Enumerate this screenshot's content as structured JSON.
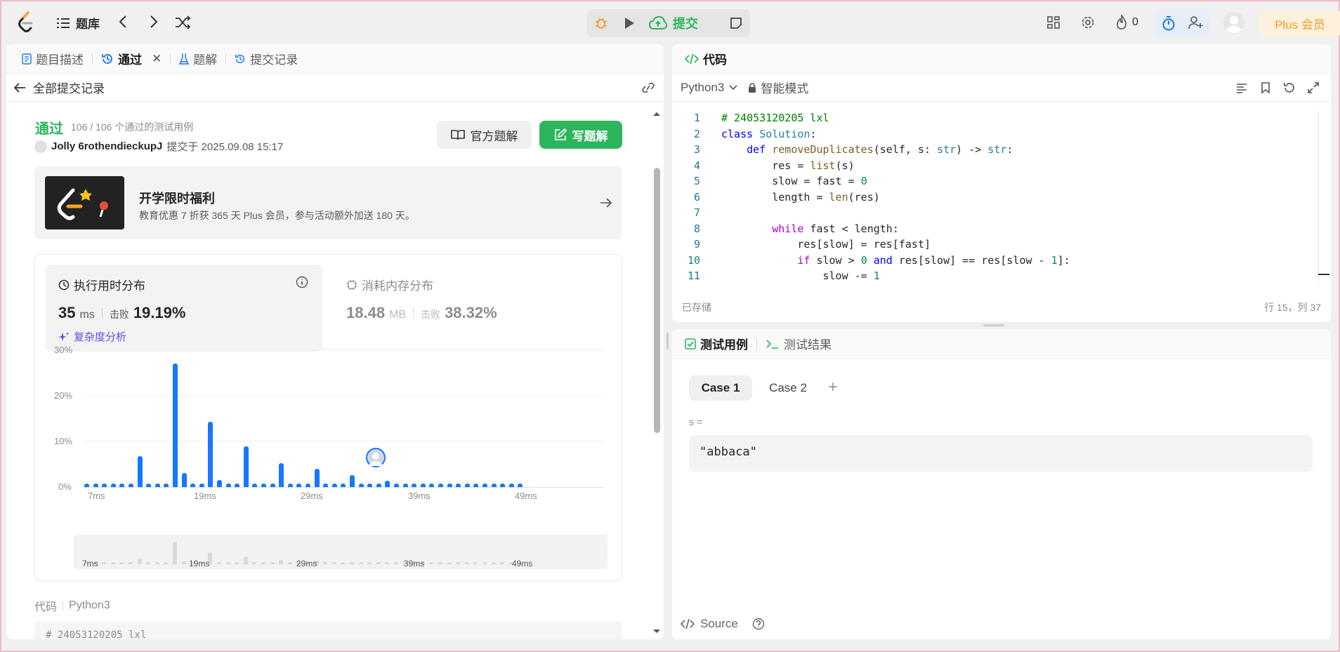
{
  "topbar": {
    "problem_bank": "题库",
    "submit": "提交",
    "streak": "0",
    "plus": "Plus 会员"
  },
  "left": {
    "tabs": [
      {
        "label": "题目描述"
      },
      {
        "label": "通过"
      },
      {
        "label": "题解"
      },
      {
        "label": "提交记录"
      }
    ],
    "back_label": "全部提交记录",
    "status": "通过",
    "cases": "106 / 106 个通过的测试用例",
    "user": "Jolly 6rothendieckupJ",
    "submitted_at": "提交于 2025.09.08 15:17",
    "official_btn": "官方题解",
    "write_btn": "写题解",
    "promo_title": "开学限时福利",
    "promo_desc": "教育优惠 7 折获 365 天 Plus 会员，参与活动额外加送 180 天。",
    "runtime_title": "执行用时分布",
    "runtime_val": "35",
    "runtime_unit": "ms",
    "beat_label": "击败",
    "runtime_beat": "19.19%",
    "complexity": "复杂度分析",
    "mem_title": "消耗内存分布",
    "mem_val": "18.48",
    "mem_unit": "MB",
    "mem_beat_label": "击败",
    "mem_beat": "38.32%",
    "code_label": "代码",
    "code_lang": "Python3",
    "code_preview": "# 24053120205 lxl"
  },
  "chart_data": {
    "type": "bar",
    "ylabel_ticks": [
      "30%",
      "20%",
      "10%",
      "0%"
    ],
    "xtick_labels": [
      "7ms",
      "19ms",
      "29ms",
      "39ms",
      "49ms"
    ],
    "ylim": [
      0,
      30
    ],
    "values": [
      0.8,
      0.8,
      0.8,
      0.8,
      0.8,
      0.8,
      6.8,
      0.8,
      0.8,
      0.8,
      27,
      3,
      0.8,
      0.8,
      14.2,
      1.5,
      0.8,
      0.8,
      8.9,
      0.8,
      0.8,
      0.8,
      5.2,
      0.8,
      0.8,
      0.8,
      4,
      0.8,
      0.8,
      0.8,
      2.6,
      0.8,
      0.8,
      0.8,
      1.4,
      0.8,
      0.8,
      0.8,
      0.8,
      0.8,
      0.8,
      0.8,
      0.8,
      0.8,
      0.8,
      0.8,
      0.8,
      0.8,
      0.8,
      0.8
    ]
  },
  "right": {
    "code_tab": "代码",
    "lang": "Python3",
    "smart": "智能模式",
    "code": [
      "# 24053120205 lxl",
      "class Solution:",
      "    def removeDuplicates(self, s: str) -> str:",
      "        res = list(s)",
      "        slow = fast = 0",
      "        length = len(res)",
      "",
      "        while fast < length:",
      "            res[slow] = res[fast]",
      "            if slow > 0 and res[slow] == res[slow - 1]:",
      "                slow -= 1"
    ],
    "saved": "已存储",
    "pos": "行 15，列 37",
    "test_tab": "测试用例",
    "result_tab": "测试结果",
    "cases": [
      "Case 1",
      "Case 2"
    ],
    "var_label": "s =",
    "var_value": "\"abbaca\"",
    "source": "Source"
  }
}
